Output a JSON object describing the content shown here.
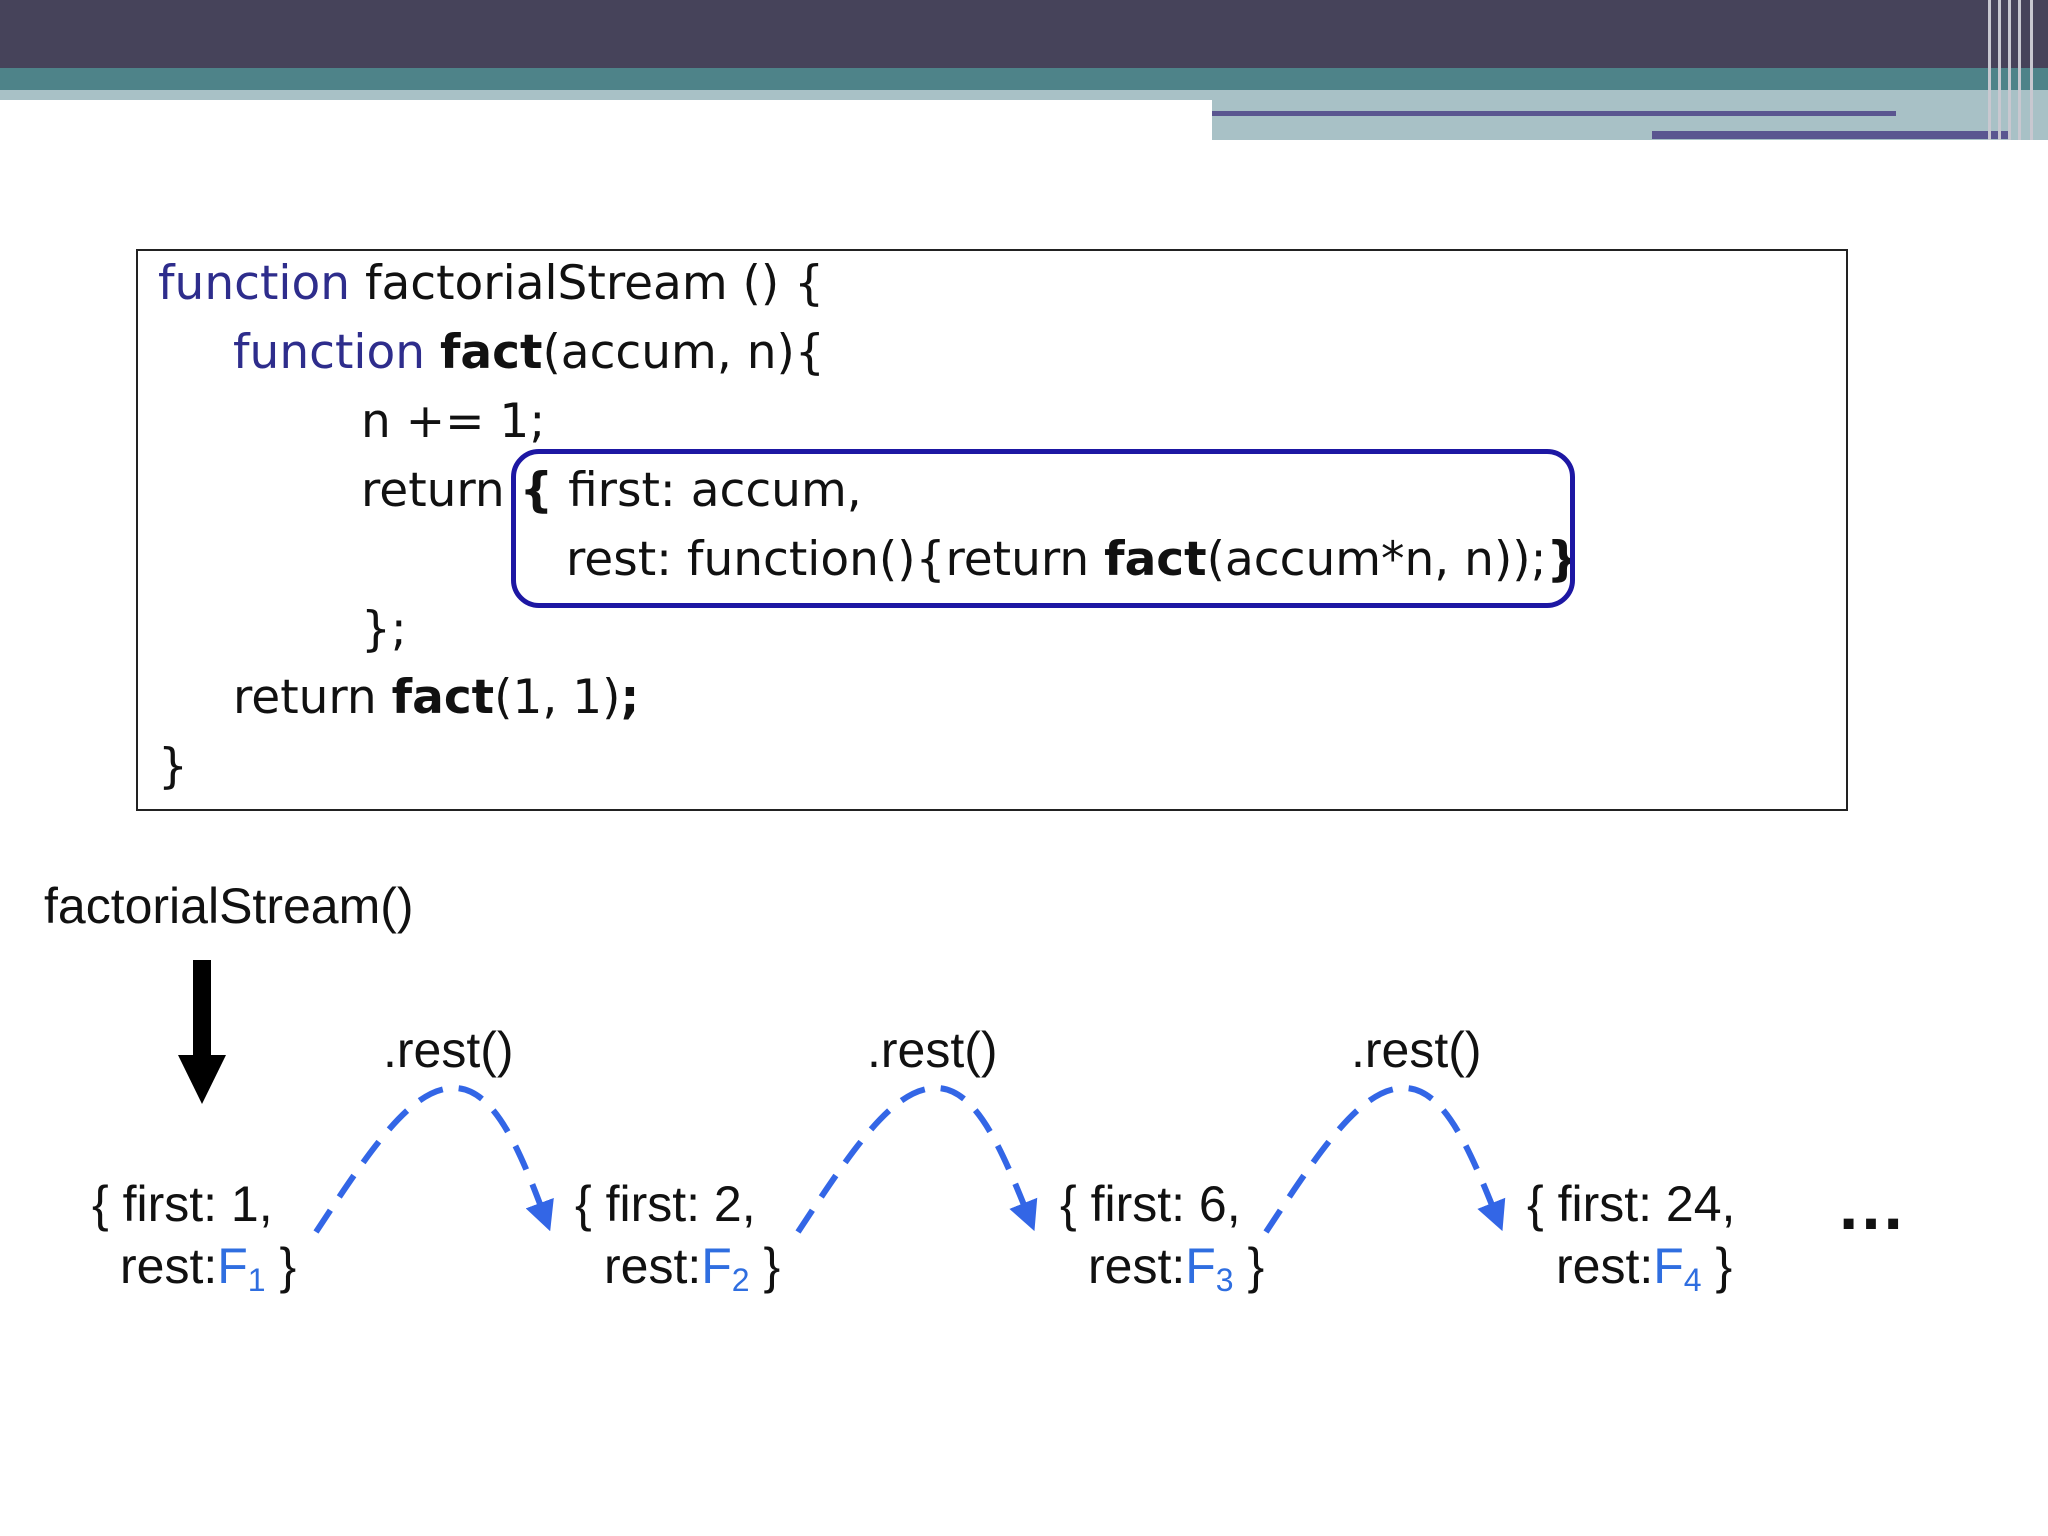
{
  "code": {
    "line1": {
      "keyword": "function",
      "rest": " factorialStream () {"
    },
    "line2": {
      "keyword": "function",
      "name": "fact",
      "rest": "(accum, n){"
    },
    "line3": "n += 1;",
    "line4": {
      "keyword": "return",
      "brace": "{",
      "rest": " first: accum,"
    },
    "line5": {
      "pre": "rest: function(){return ",
      "name": "fact",
      "post": "(accum*n, n));",
      "brace": "}"
    },
    "line6": "};",
    "line7": {
      "keyword": "return ",
      "name": "fact",
      "post": "(1, 1)",
      "semi": ";"
    },
    "line8": "}"
  },
  "diagram": {
    "start_label": "factorialStream()",
    "call_label": ".rest()",
    "nodes": [
      {
        "first_line": "{ first: 1,",
        "rest_prefix": "rest:",
        "func": "F",
        "sub": "1",
        "close": " }"
      },
      {
        "first_line": "{ first: 2,",
        "rest_prefix": "rest:",
        "func": "F",
        "sub": "2",
        "close": " }"
      },
      {
        "first_line": "{ first: 6,",
        "rest_prefix": "rest:",
        "func": "F",
        "sub": "3",
        "close": " }"
      },
      {
        "first_line": "{ first: 24,",
        "rest_prefix": "rest:",
        "func": "F",
        "sub": "4",
        "close": " }"
      }
    ],
    "ellipsis": "…",
    "colors": {
      "arrow": "#3366e6",
      "func_name": "#2f6ee0",
      "highlight_box": "#1d17a3",
      "keyword": "#2e2d8c"
    }
  }
}
